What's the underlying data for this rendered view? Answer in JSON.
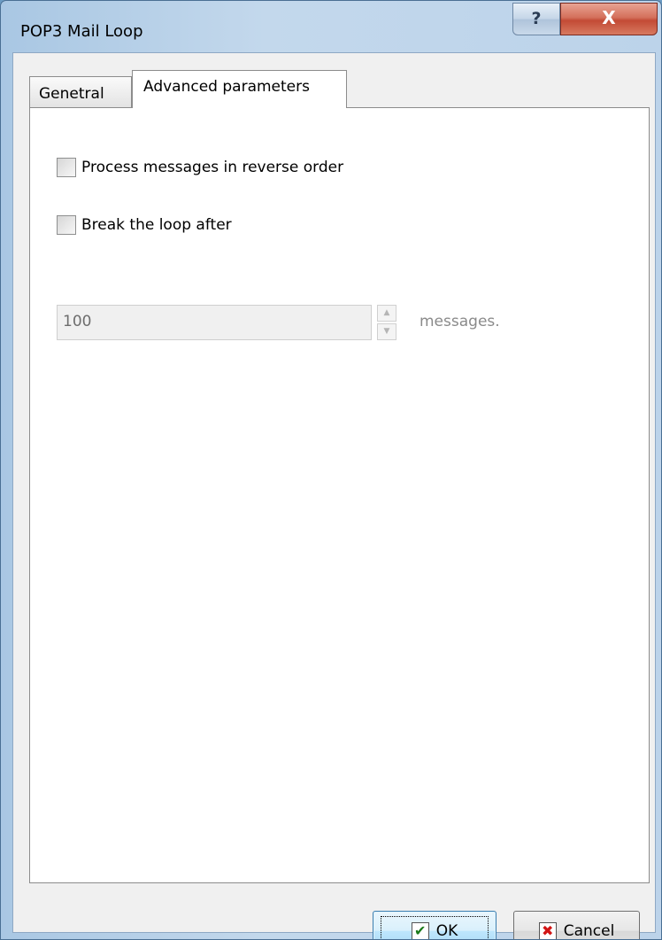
{
  "window": {
    "title": "POP3 Mail Loop",
    "help_label": "?",
    "close_label": "X"
  },
  "tabs": [
    {
      "label": "Genetral",
      "active": false
    },
    {
      "label": "Advanced parameters",
      "active": true
    }
  ],
  "advanced": {
    "reverse_order_label": "Process messages in reverse order",
    "reverse_order_checked": false,
    "break_loop_label": "Break the loop after",
    "break_loop_checked": false,
    "count_value": "100",
    "count_suffix": "messages.",
    "spin_up": "▲",
    "spin_down": "▼"
  },
  "buttons": {
    "ok_label": "OK",
    "ok_icon": "✔",
    "cancel_label": "Cancel",
    "cancel_icon": "✖"
  },
  "colors": {
    "titlebar": "#bcd3ea",
    "close_button": "#c34a35",
    "ok_check": "#1a7a1a",
    "cancel_x": "#d21515"
  }
}
